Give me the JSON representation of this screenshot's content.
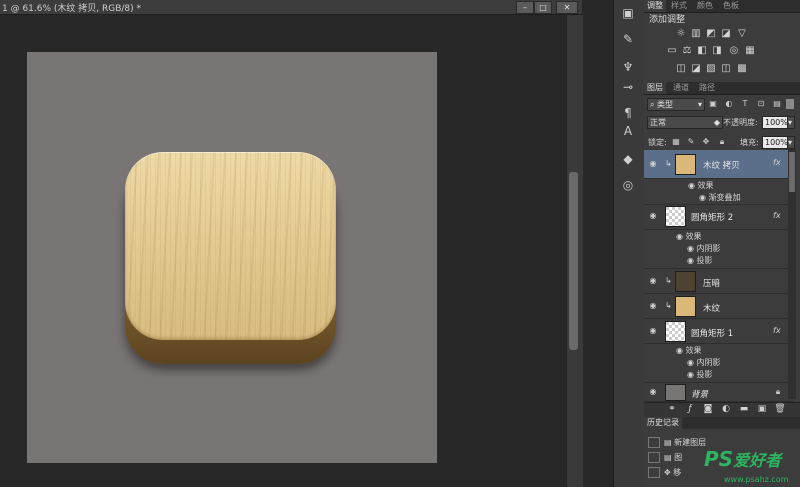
{
  "document": {
    "title": "1 @ 61.6% (木纹 拷贝, RGB/8) *",
    "win_buttons": [
      "–",
      "□",
      "✕"
    ]
  },
  "tools": [
    "layers-icon",
    "brush-icon",
    "character-icon",
    "paragraph-icon",
    "text-icon",
    "cube-icon",
    "3d-icon"
  ],
  "adjustments": {
    "tabs": [
      "调整",
      "样式",
      "颜色",
      "色板"
    ],
    "title": "添加调整",
    "row1": [
      "☼",
      "▥",
      "◩",
      "◪",
      "▽"
    ],
    "row2": [
      "▭",
      "⚖",
      "◧",
      "◨",
      "◎",
      "▦"
    ],
    "row3": [
      "◫",
      "◪",
      "▨",
      "◫",
      "▩"
    ]
  },
  "layers_panel": {
    "tabs": [
      "图层",
      "通道",
      "路径"
    ],
    "filter_label": "类型",
    "blend_mode": "正常",
    "opacity_label": "不透明度:",
    "opacity_value": "100%",
    "lock_label": "锁定:",
    "fill_label": "填充:",
    "fill_value": "100%",
    "layers": [
      {
        "name": "木纹 拷贝",
        "fx": "fx",
        "selected": true,
        "effects": [
          "效果",
          "渐变叠加"
        ]
      },
      {
        "name": "圆角矩形 2",
        "fx": "fx",
        "effects": [
          "效果",
          "内阴影",
          "投影"
        ]
      },
      {
        "name": "压暗"
      },
      {
        "name": "木纹"
      },
      {
        "name": "圆角矩形 1",
        "fx": "fx",
        "effects": [
          "效果",
          "内阴影",
          "投影"
        ]
      },
      {
        "name": "背景"
      }
    ]
  },
  "history": {
    "tab": "历史记录",
    "items": [
      "新建图层",
      "图",
      "移"
    ]
  },
  "watermark": {
    "brand": "PS",
    "text": "爱好者",
    "url": "www.psahz.com"
  },
  "colors": {
    "artboard": "#7a7575",
    "wood": "#e2c98f",
    "selected_layer": "#5b6f8a"
  }
}
